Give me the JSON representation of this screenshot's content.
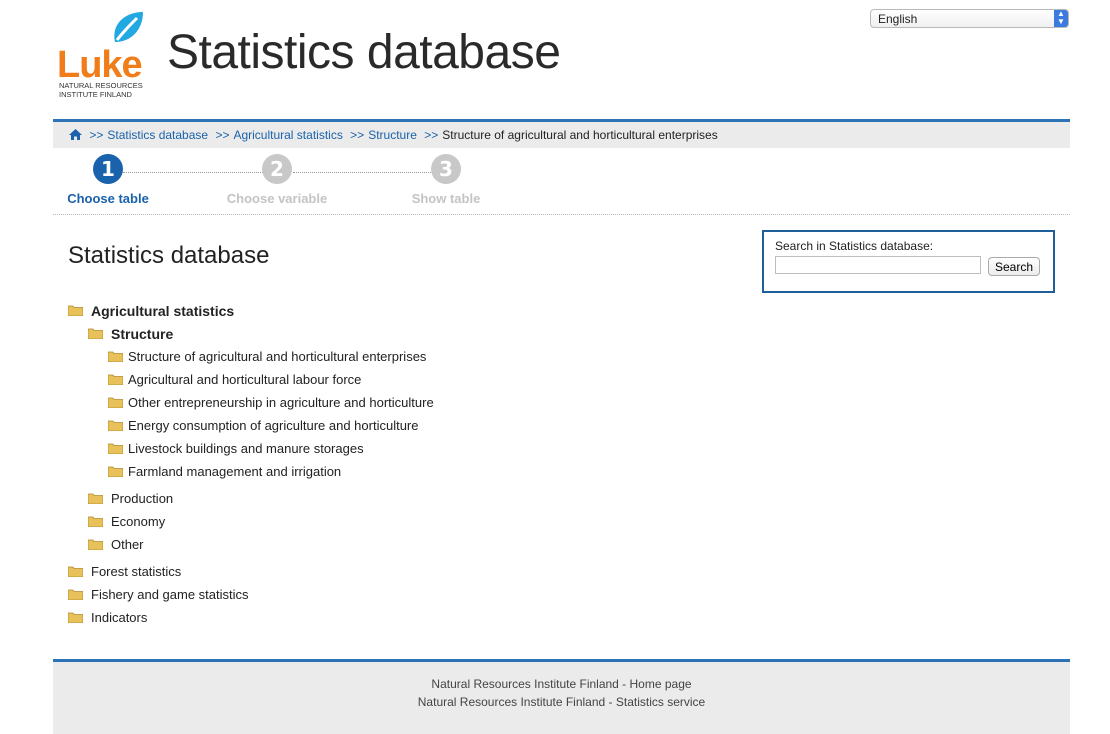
{
  "header": {
    "logo_text": "Luke",
    "logo_subtitle_line1": "NATURAL RESOURCES",
    "logo_subtitle_line2": "INSTITUTE FINLAND",
    "site_title": "Statistics database",
    "language": "English"
  },
  "breadcrumb": {
    "items": [
      "Statistics database",
      "Agricultural statistics",
      "Structure"
    ],
    "separator": ">>",
    "current": "Structure of agricultural and horticultural enterprises"
  },
  "steps": [
    {
      "number": "1",
      "label": "Choose table"
    },
    {
      "number": "2",
      "label": "Choose variable"
    },
    {
      "number": "3",
      "label": "Show table"
    }
  ],
  "main": {
    "title": "Statistics database"
  },
  "search": {
    "label": "Search in Statistics database:",
    "value": "",
    "button": "Search"
  },
  "tree": {
    "agricultural": "Agricultural statistics",
    "structure": "Structure",
    "structure_children": [
      "Structure of agricultural and horticultural enterprises",
      "Agricultural and horticultural labour force",
      "Other entrepreneurship in agriculture and horticulture",
      "Energy consumption of agriculture and horticulture",
      "Livestock buildings and manure storages",
      "Farmland management and irrigation"
    ],
    "production": "Production",
    "economy": "Economy",
    "other": "Other",
    "forest": "Forest statistics",
    "fishery": "Fishery and game statistics",
    "indicators": "Indicators"
  },
  "footer": {
    "home_link": "Natural Resources Institute Finland - Home page",
    "stats_link": "Natural Resources Institute Finland - Statistics service"
  },
  "colors": {
    "brand_blue": "#1a62ab",
    "logo_orange": "#f07d1a",
    "logo_leaf": "#23a9e1"
  }
}
